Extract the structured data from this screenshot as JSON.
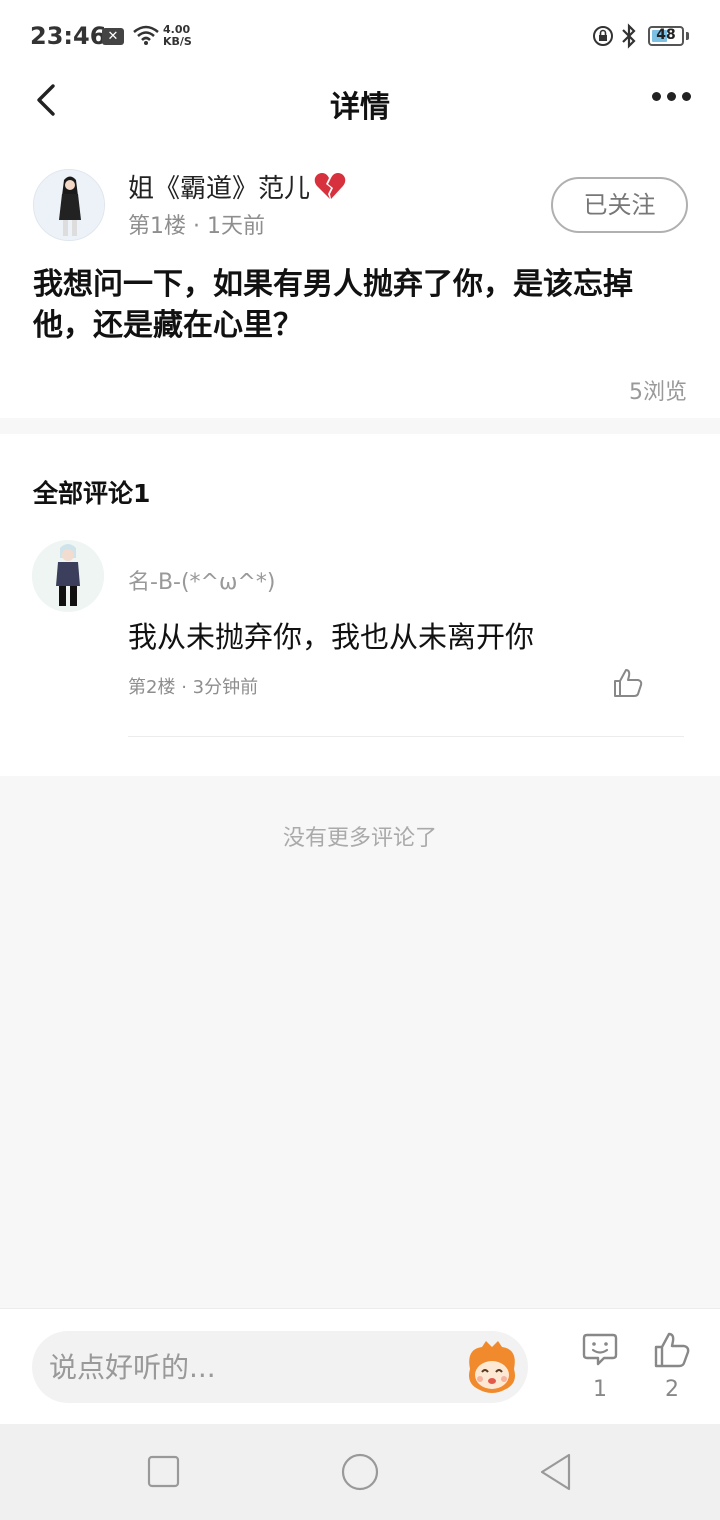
{
  "status_bar": {
    "time": "23:46",
    "speed_value": "4.00",
    "speed_unit": "KB/S",
    "battery_level": "48"
  },
  "header": {
    "title": "详情"
  },
  "post": {
    "author": "姐《霸道》范儿",
    "floor": "第1楼",
    "time_ago": "1天前",
    "follow_label": "已关注",
    "body": "我想问一下，如果有男人抛弃了你，是该忘掉他，还是藏在心里？",
    "views": "5浏览"
  },
  "comments": {
    "heading": "全部评论1",
    "items": [
      {
        "author": "名-B-(*^ω^*)",
        "text": "我从未抛弃你，我也从未离开你",
        "floor": "第2楼",
        "time_ago": "3分钟前"
      }
    ],
    "no_more": "没有更多评论了"
  },
  "bottom_bar": {
    "input_placeholder": "说点好听的...",
    "comment_count": "1",
    "like_count": "2"
  },
  "colors": {
    "background": "#f7f7f7",
    "card": "#ffffff",
    "text_primary": "#111111",
    "text_secondary": "#8e8e8e",
    "emoji_accent": "#f08a2c"
  },
  "icons": [
    "back-arrow-icon",
    "more-icon",
    "broken-heart-icon",
    "thumbs-up-icon",
    "comment-bubble-icon",
    "emoji-mascot-icon",
    "wifi-icon",
    "bluetooth-icon",
    "lock-rotation-icon"
  ]
}
